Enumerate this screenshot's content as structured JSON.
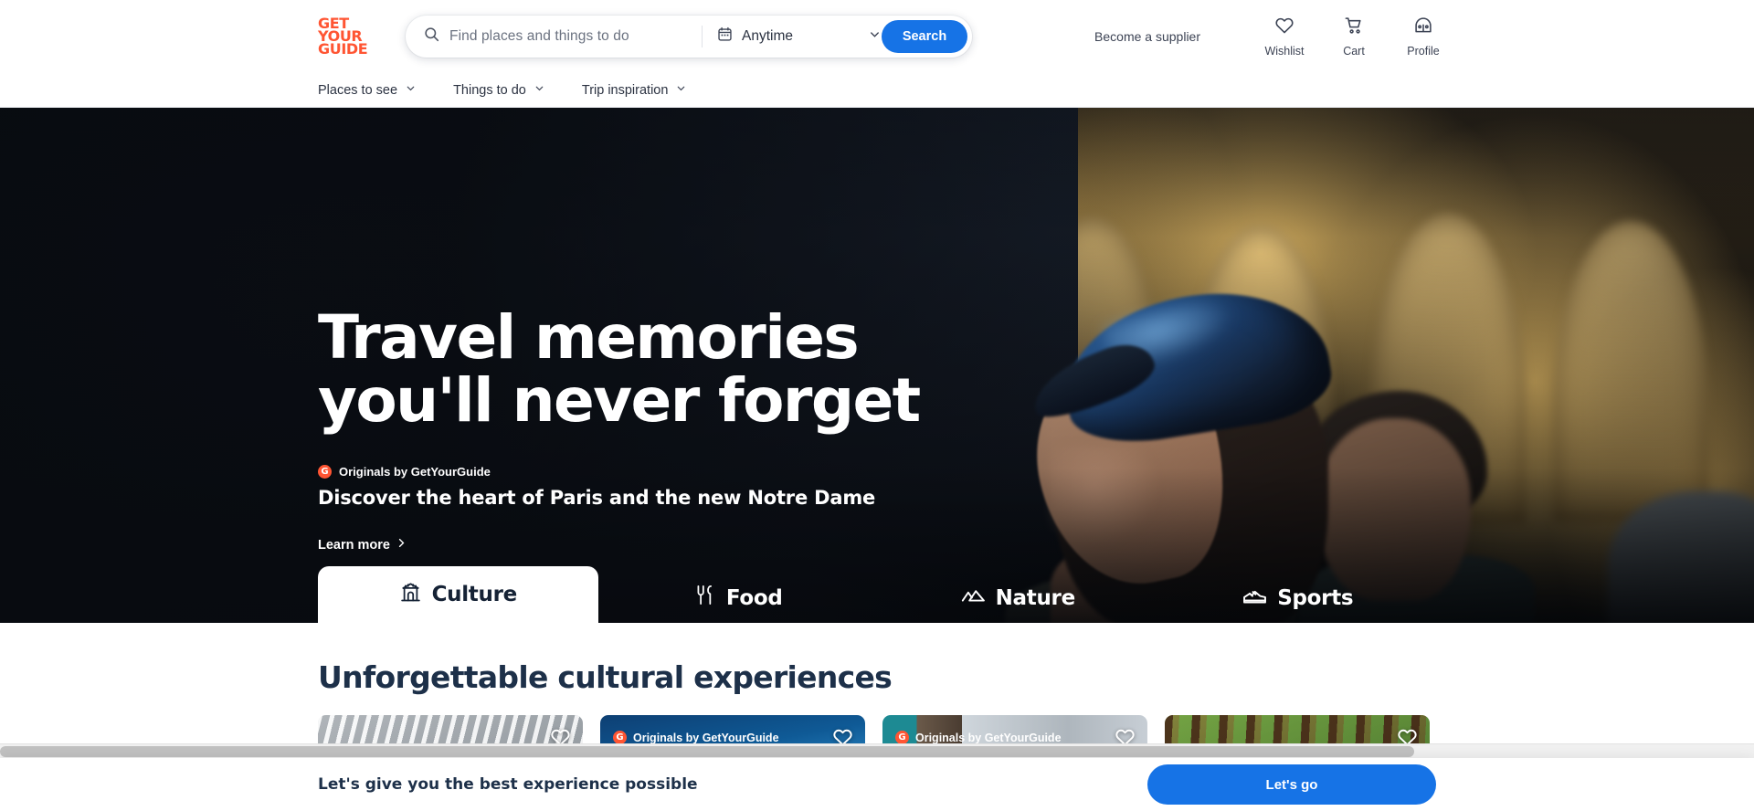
{
  "brand": {
    "logo_line1": "GET",
    "logo_line2": "YOUR",
    "logo_line3": "GUIDE",
    "accent_orange": "#ff5533",
    "accent_blue": "#1673e6",
    "navy": "#1d3049"
  },
  "header": {
    "search": {
      "placeholder": "Find places and things to do",
      "search_icon": "search-icon",
      "date_icon": "calendar-icon",
      "date_value": "Anytime",
      "chevron_icon": "chevron-down-icon",
      "button_label": "Search"
    },
    "supplier_label": "Become a supplier",
    "icons": [
      {
        "name": "wishlist-icon",
        "glyph": "heart",
        "label": "Wishlist"
      },
      {
        "name": "cart-icon",
        "glyph": "cart",
        "label": "Cart"
      },
      {
        "name": "profile-icon",
        "glyph": "profile",
        "label": "Profile"
      }
    ]
  },
  "nav": {
    "items": [
      {
        "label": "Places to see",
        "icon": "chevron-down-icon"
      },
      {
        "label": "Things to do",
        "icon": "chevron-down-icon"
      },
      {
        "label": "Trip inspiration",
        "icon": "chevron-down-icon"
      }
    ]
  },
  "hero": {
    "title_line1": "Travel memories",
    "title_line2": "you'll never forget",
    "badge": {
      "mark": "G",
      "text": "Originals by GetYourGuide"
    },
    "subtitle": "Discover the heart of Paris and the new Notre Dame",
    "learn_more": "Learn more",
    "learn_more_icon": "chevron-right-icon",
    "tabs": [
      {
        "label": "Culture",
        "icon": "monument-icon",
        "active": true
      },
      {
        "label": "Food",
        "icon": "cutlery-icon",
        "active": false
      },
      {
        "label": "Nature",
        "icon": "mountains-icon",
        "active": false
      },
      {
        "label": "Sports",
        "icon": "sneaker-icon",
        "active": false
      }
    ]
  },
  "section": {
    "title": "Unforgettable cultural experiences",
    "cards": [
      {
        "badge": "",
        "heart_icon": "heart-outline-icon"
      },
      {
        "badge": "Originals by GetYourGuide",
        "badge_mark": "G",
        "heart_icon": "heart-outline-icon"
      },
      {
        "badge": "Originals by GetYourGuide",
        "badge_mark": "G",
        "heart_icon": "heart-outline-icon"
      },
      {
        "badge": "",
        "heart_icon": "heart-outline-icon"
      }
    ]
  },
  "consent": {
    "text": "Let's give you the best experience possible",
    "button_label": "Let's go"
  }
}
